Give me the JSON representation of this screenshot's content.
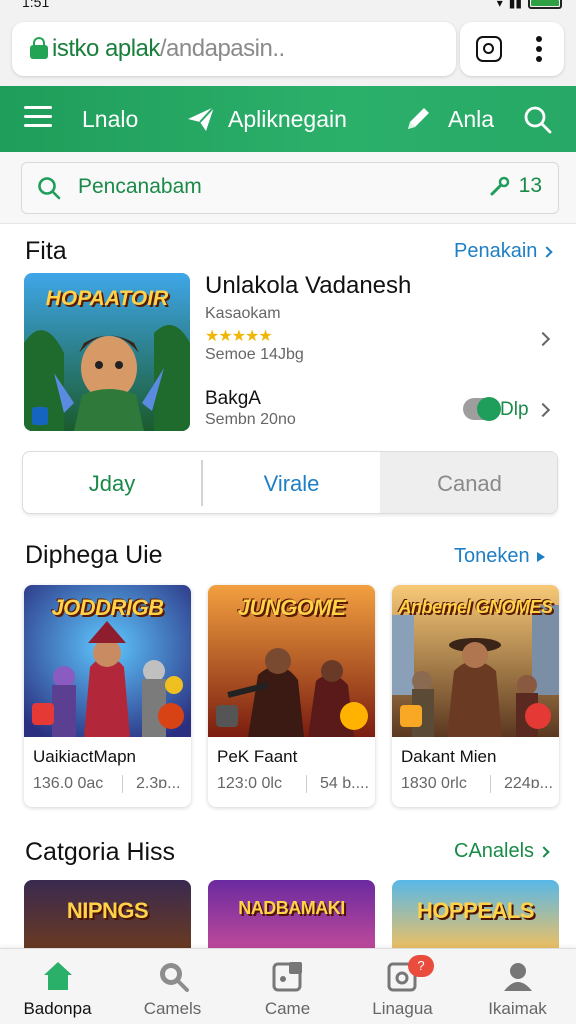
{
  "status": {
    "time": "1:51"
  },
  "browser": {
    "url_host": "istko aplak",
    "url_path": "/andapasin.."
  },
  "nav": {
    "item1": "Lnalo",
    "item2": "Apliknegain",
    "item3": "Anla"
  },
  "search": {
    "placeholder": "Pencanabam",
    "count": "13"
  },
  "featured": {
    "section_title": "Fita",
    "section_link": "Penakain",
    "title": "Unlakola Vadanesh",
    "subtitle": "Kasaokam",
    "rating_stars": "★★★★★",
    "size": "Semoe 14Jbg",
    "name2": "BakgA",
    "version": "Sembn 20no",
    "toggle_label": "Dlp",
    "art_title": "HOPAATOIR"
  },
  "tabs": [
    {
      "label": "Jday"
    },
    {
      "label": "Virale"
    },
    {
      "label": "Canad"
    }
  ],
  "games_section": {
    "title": "Diphega Uie",
    "link": "Toneken"
  },
  "games": [
    {
      "art_title": "JODDRIGB",
      "name": "UaikiactMapn",
      "meta": "136.0 0ac",
      "meta2": "2.3ɒ..."
    },
    {
      "art_title": "JUNGOME",
      "name": "PeK Faant",
      "meta": "123:0 0lc",
      "meta2": "54 b...."
    },
    {
      "art_title": "Anbemel GNOMES",
      "name": "Dakant Mien",
      "meta": "1830 0rlc",
      "meta2": "224ɒ..."
    }
  ],
  "category_section": {
    "title": "Catgoria Hiss",
    "link": "CAnalels"
  },
  "categories": [
    {
      "art_title": "NIPNGS"
    },
    {
      "art_title": "NADBAMAKI"
    },
    {
      "art_title": "HOPPEALS"
    }
  ],
  "bottom_nav": [
    {
      "label": "Badonpa",
      "icon": "home-icon"
    },
    {
      "label": "Camels",
      "icon": "search-game-icon"
    },
    {
      "label": "Came",
      "icon": "game-icon"
    },
    {
      "label": "Linagua",
      "icon": "updates-icon"
    },
    {
      "label": "Ikaimak",
      "icon": "profile-icon"
    }
  ],
  "notification_badge": "?",
  "colors": {
    "brand_green": "#1f9d5a",
    "link_blue": "#1e7fc4",
    "star": "#f2b705",
    "badge_red": "#e94b3c"
  }
}
